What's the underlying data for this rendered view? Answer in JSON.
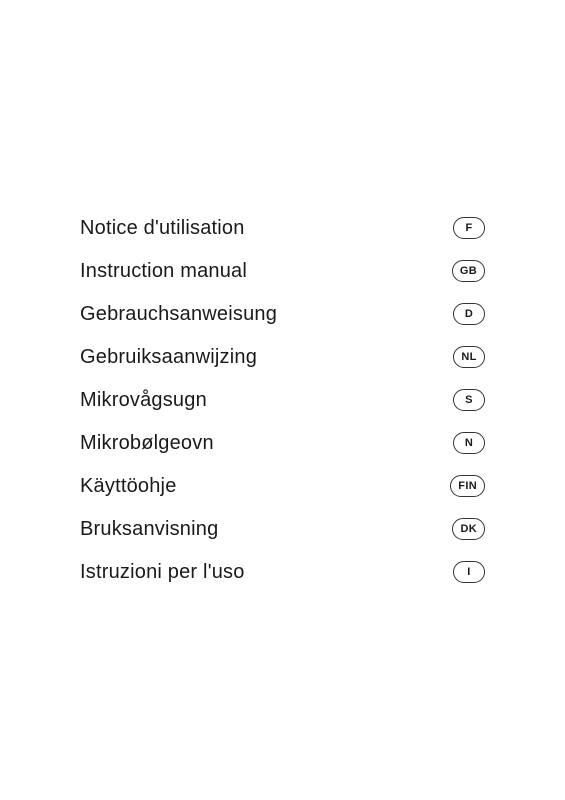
{
  "items": [
    {
      "label": "Notice d'utilisation",
      "lang": "F"
    },
    {
      "label": "Instruction manual",
      "lang": "GB"
    },
    {
      "label": "Gebrauchsanweisung",
      "lang": "D"
    },
    {
      "label": "Gebruiksaanwijzing",
      "lang": "NL"
    },
    {
      "label": "Mikrovågsugn",
      "lang": "S"
    },
    {
      "label": "Mikrobølgeovn",
      "lang": "N"
    },
    {
      "label": "Käyttöohje",
      "lang": "FIN"
    },
    {
      "label": "Bruksanvisning",
      "lang": "DK"
    },
    {
      "label": "Istruzioni per l'uso",
      "lang": "I"
    }
  ]
}
